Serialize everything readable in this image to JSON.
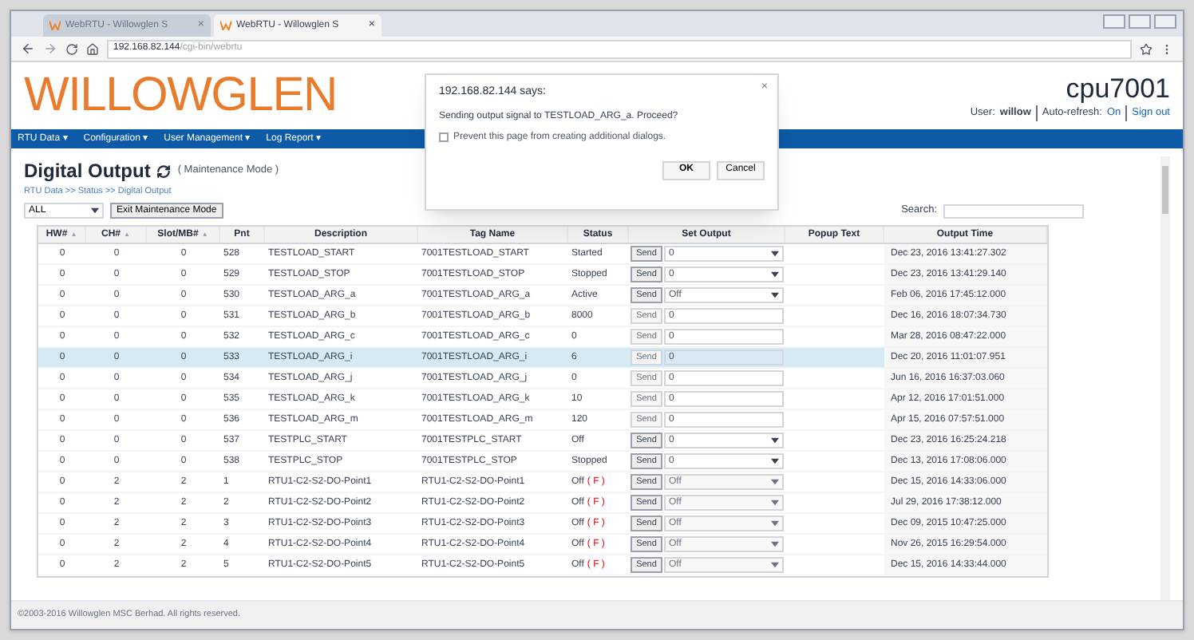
{
  "browser": {
    "tabs": [
      {
        "label": "WebRTU - Willowglen S",
        "close": "×",
        "selected": false
      },
      {
        "label": "WebRTU - Willowglen S",
        "close": "×",
        "selected": true
      }
    ],
    "address": {
      "host": "192.168.82.144",
      "path": "/cgi-bin/webrtu"
    }
  },
  "header": {
    "logo": "WILLOWGLEN",
    "device": "cpu7001",
    "user_label": "User:",
    "user": "willow",
    "refresh_label": "Auto-refresh:",
    "refresh_value": "On",
    "sign_out": "Sign out"
  },
  "nav": [
    {
      "label": "RTU Data",
      "caret": "▾"
    },
    {
      "label": "Configuration",
      "caret": "▾"
    },
    {
      "label": "User Management",
      "caret": "▾"
    },
    {
      "label": "Log Report",
      "caret": "▾"
    }
  ],
  "page": {
    "title": "Digital Output",
    "mode": "( Maintenance Mode )",
    "breadcrumb": "RTU Data >> Status >> Digital Output",
    "filter": "ALL",
    "exit_button": "Exit Maintenance Mode",
    "search_label": "Search:"
  },
  "table": {
    "columns": [
      {
        "label": "HW#",
        "sort": "▲"
      },
      {
        "label": "CH#",
        "sort": "▲"
      },
      {
        "label": "Slot/MB#",
        "sort": "▲"
      },
      {
        "label": "Pnt"
      },
      {
        "label": "Description"
      },
      {
        "label": "Tag Name"
      },
      {
        "label": "Status"
      },
      {
        "label": "Set Output"
      },
      {
        "label": "Popup Text"
      },
      {
        "label": "Output Time"
      }
    ],
    "rows": [
      {
        "hw": "0",
        "ch": "0",
        "slot": "0",
        "pnt": "528",
        "description": "TESTLOAD_START",
        "tag": "7001TESTLOAD_START",
        "status": "Started",
        "send": "Send",
        "send_disabled": false,
        "kind": "select",
        "value": "0",
        "field_disabled": false,
        "time": "Dec 23, 2016 13:41:27.302",
        "selected": false
      },
      {
        "hw": "0",
        "ch": "0",
        "slot": "0",
        "pnt": "529",
        "description": "TESTLOAD_STOP",
        "tag": "7001TESTLOAD_STOP",
        "status": "Stopped",
        "send": "Send",
        "send_disabled": false,
        "kind": "select",
        "value": "0",
        "field_disabled": false,
        "time": "Dec 23, 2016 13:41:29.140",
        "selected": false
      },
      {
        "hw": "0",
        "ch": "0",
        "slot": "0",
        "pnt": "530",
        "description": "TESTLOAD_ARG_a",
        "tag": "7001TESTLOAD_ARG_a",
        "status": "Active",
        "send": "Send",
        "send_disabled": false,
        "kind": "select",
        "value": "Off",
        "field_disabled": false,
        "time": "Feb 06, 2016 17:45:12.000",
        "selected": false
      },
      {
        "hw": "0",
        "ch": "0",
        "slot": "0",
        "pnt": "531",
        "description": "TESTLOAD_ARG_b",
        "tag": "7001TESTLOAD_ARG_b",
        "status": "8000",
        "send": "Send",
        "send_disabled": true,
        "kind": "input",
        "value": "0",
        "field_disabled": false,
        "time": "Dec 16, 2016 18:07:34.730",
        "selected": false
      },
      {
        "hw": "0",
        "ch": "0",
        "slot": "0",
        "pnt": "532",
        "description": "TESTLOAD_ARG_c",
        "tag": "7001TESTLOAD_ARG_c",
        "status": "0",
        "send": "Send",
        "send_disabled": true,
        "kind": "input",
        "value": "0",
        "field_disabled": false,
        "time": "Mar 28, 2016 08:47:22.000",
        "selected": false
      },
      {
        "hw": "0",
        "ch": "0",
        "slot": "0",
        "pnt": "533",
        "description": "TESTLOAD_ARG_i",
        "tag": "7001TESTLOAD_ARG_i",
        "status": "6",
        "send": "Send",
        "send_disabled": true,
        "kind": "input",
        "value": "0",
        "field_disabled": false,
        "time": "Dec 20, 2016 11:01:07.951",
        "selected": true
      },
      {
        "hw": "0",
        "ch": "0",
        "slot": "0",
        "pnt": "534",
        "description": "TESTLOAD_ARG_j",
        "tag": "7001TESTLOAD_ARG_j",
        "status": "0",
        "send": "Send",
        "send_disabled": true,
        "kind": "input",
        "value": "0",
        "field_disabled": false,
        "time": "Jun 16, 2016 16:37:03.060",
        "selected": false
      },
      {
        "hw": "0",
        "ch": "0",
        "slot": "0",
        "pnt": "535",
        "description": "TESTLOAD_ARG_k",
        "tag": "7001TESTLOAD_ARG_k",
        "status": "10",
        "send": "Send",
        "send_disabled": true,
        "kind": "input",
        "value": "0",
        "field_disabled": false,
        "time": "Apr 12, 2016 17:01:51.000",
        "selected": false
      },
      {
        "hw": "0",
        "ch": "0",
        "slot": "0",
        "pnt": "536",
        "description": "TESTLOAD_ARG_m",
        "tag": "7001TESTLOAD_ARG_m",
        "status": "120",
        "send": "Send",
        "send_disabled": true,
        "kind": "input",
        "value": "0",
        "field_disabled": false,
        "time": "Apr 15, 2016 07:57:51.000",
        "selected": false
      },
      {
        "hw": "0",
        "ch": "0",
        "slot": "0",
        "pnt": "537",
        "description": "TESTPLC_START",
        "tag": "7001TESTPLC_START",
        "status": "Off",
        "send": "Send",
        "send_disabled": false,
        "kind": "select",
        "value": "0",
        "field_disabled": false,
        "time": "Dec 23, 2016 16:25:24.218",
        "selected": false
      },
      {
        "hw": "0",
        "ch": "0",
        "slot": "0",
        "pnt": "538",
        "description": "TESTPLC_STOP",
        "tag": "7001TESTPLC_STOP",
        "status": "Stopped",
        "send": "Send",
        "send_disabled": false,
        "kind": "select",
        "value": "0",
        "field_disabled": false,
        "time": "Dec 13, 2016 17:08:06.000",
        "selected": false
      },
      {
        "hw": "0",
        "ch": "2",
        "slot": "2",
        "pnt": "1",
        "description": "RTU1-C2-S2-DO-Point1",
        "tag": "RTU1-C2-S2-DO-Point1",
        "status": "Off",
        "flag": "( F )",
        "send": "Send",
        "send_disabled": false,
        "kind": "select",
        "value": "Off",
        "field_disabled": true,
        "time": "Dec 15, 2016 14:33:06.000",
        "selected": false
      },
      {
        "hw": "0",
        "ch": "2",
        "slot": "2",
        "pnt": "2",
        "description": "RTU1-C2-S2-DO-Point2",
        "tag": "RTU1-C2-S2-DO-Point2",
        "status": "Off",
        "flag": "( F )",
        "send": "Send",
        "send_disabled": false,
        "kind": "select",
        "value": "Off",
        "field_disabled": true,
        "time": "Jul 29, 2016 17:38:12.000",
        "selected": false
      },
      {
        "hw": "0",
        "ch": "2",
        "slot": "2",
        "pnt": "3",
        "description": "RTU1-C2-S2-DO-Point3",
        "tag": "RTU1-C2-S2-DO-Point3",
        "status": "Off",
        "flag": "( F )",
        "send": "Send",
        "send_disabled": false,
        "kind": "select",
        "value": "Off",
        "field_disabled": true,
        "time": "Dec 09, 2015 10:47:25.000",
        "selected": false
      },
      {
        "hw": "0",
        "ch": "2",
        "slot": "2",
        "pnt": "4",
        "description": "RTU1-C2-S2-DO-Point4",
        "tag": "RTU1-C2-S2-DO-Point4",
        "status": "Off",
        "flag": "( F )",
        "send": "Send",
        "send_disabled": false,
        "kind": "select",
        "value": "Off",
        "field_disabled": true,
        "time": "Nov 26, 2015 16:29:54.000",
        "selected": false
      },
      {
        "hw": "0",
        "ch": "2",
        "slot": "2",
        "pnt": "5",
        "description": "RTU1-C2-S2-DO-Point5",
        "tag": "RTU1-C2-S2-DO-Point5",
        "status": "Off",
        "flag": "( F )",
        "send": "Send",
        "send_disabled": false,
        "kind": "select",
        "value": "Off",
        "field_disabled": true,
        "time": "Dec 15, 2016 14:33:44.000",
        "selected": false
      }
    ]
  },
  "footer": "©2003-2016 Willowglen MSC Berhad. All rights reserved.",
  "dialog": {
    "title": "192.168.82.144 says:",
    "message": "Sending output signal to TESTLOAD_ARG_a. Proceed?",
    "checkbox": {
      "label": "Prevent this page from creating additional dialogs.",
      "checked": false
    },
    "close": "×",
    "buttons": [
      "OK",
      "Cancel"
    ]
  }
}
